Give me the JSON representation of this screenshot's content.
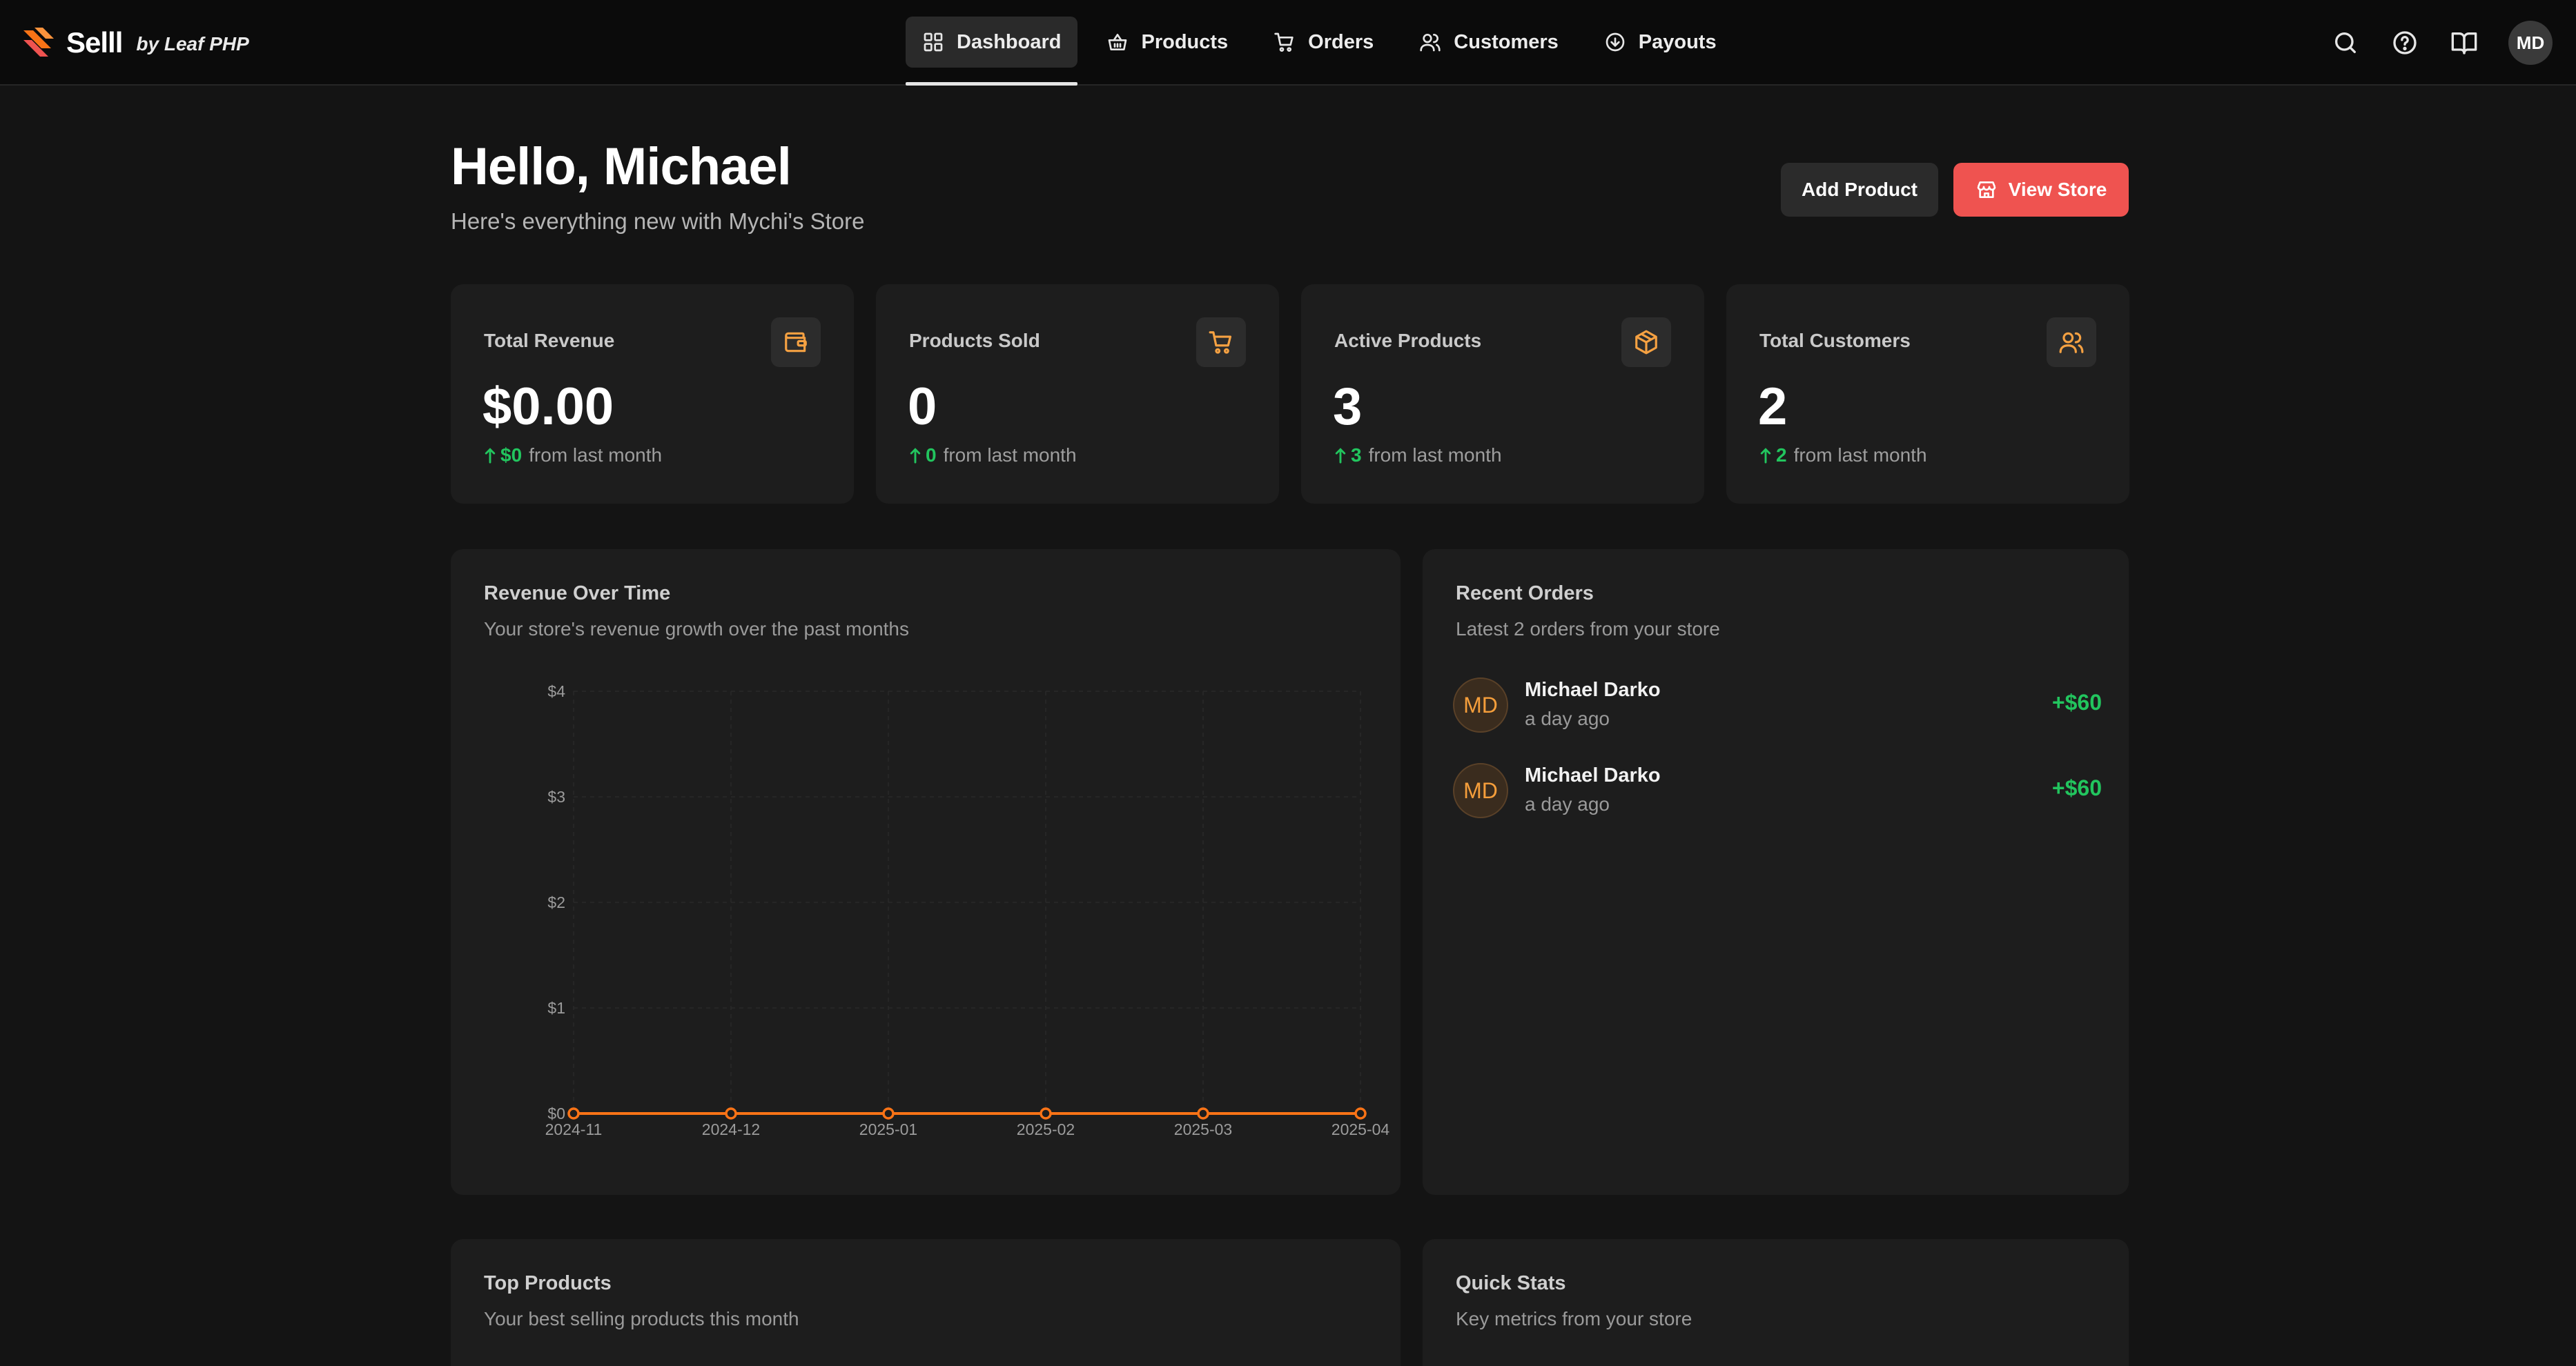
{
  "app": {
    "name": "Selll",
    "by": "by Leaf PHP"
  },
  "nav": {
    "items": [
      {
        "label": "Dashboard",
        "icon": "grid-icon",
        "active": true
      },
      {
        "label": "Products",
        "icon": "basket-icon",
        "active": false
      },
      {
        "label": "Orders",
        "icon": "cart-icon",
        "active": false
      },
      {
        "label": "Customers",
        "icon": "users-icon",
        "active": false
      },
      {
        "label": "Payouts",
        "icon": "circle-arrow-icon",
        "active": false
      }
    ],
    "user_initials": "MD"
  },
  "header": {
    "greeting": "Hello, Michael",
    "subtitle": "Here's everything new with Mychi's Store",
    "add_product_label": "Add Product",
    "view_store_label": "View Store"
  },
  "stats": [
    {
      "title": "Total Revenue",
      "value": "$0.00",
      "change": "$0",
      "change_suffix": "from last month",
      "icon": "wallet-icon"
    },
    {
      "title": "Products Sold",
      "value": "0",
      "change": "0",
      "change_suffix": "from last month",
      "icon": "cart-icon"
    },
    {
      "title": "Active Products",
      "value": "3",
      "change": "3",
      "change_suffix": "from last month",
      "icon": "package-icon"
    },
    {
      "title": "Total Customers",
      "value": "2",
      "change": "2",
      "change_suffix": "from last month",
      "icon": "users-icon"
    }
  ],
  "revenue_panel": {
    "title": "Revenue Over Time",
    "subtitle": "Your store's revenue growth over the past months"
  },
  "chart_data": {
    "type": "line",
    "title": "Revenue Over Time",
    "categories": [
      "2024-11",
      "2024-12",
      "2025-01",
      "2025-02",
      "2025-03",
      "2025-04"
    ],
    "series": [
      {
        "values": [
          0,
          0,
          0,
          0,
          0,
          0
        ]
      }
    ],
    "yticks": [
      "$0",
      "$1",
      "$2",
      "$3",
      "$4"
    ],
    "ylim": [
      0,
      4
    ],
    "grid": true,
    "color": "#f97316"
  },
  "recent_orders": {
    "title": "Recent Orders",
    "subtitle": "Latest 2 orders from your store",
    "items": [
      {
        "initials": "MD",
        "name": "Michael Darko",
        "time": "a day ago",
        "amount": "+$60"
      },
      {
        "initials": "MD",
        "name": "Michael Darko",
        "time": "a day ago",
        "amount": "+$60"
      }
    ]
  },
  "top_products": {
    "title": "Top Products",
    "subtitle": "Your best selling products this month"
  },
  "quick_stats": {
    "title": "Quick Stats",
    "subtitle": "Key metrics from your store"
  },
  "colors": {
    "accent": "#ef5350",
    "brand_orange": "#f97316",
    "positive": "#22c55e",
    "icon_orange": "#f5a142"
  }
}
